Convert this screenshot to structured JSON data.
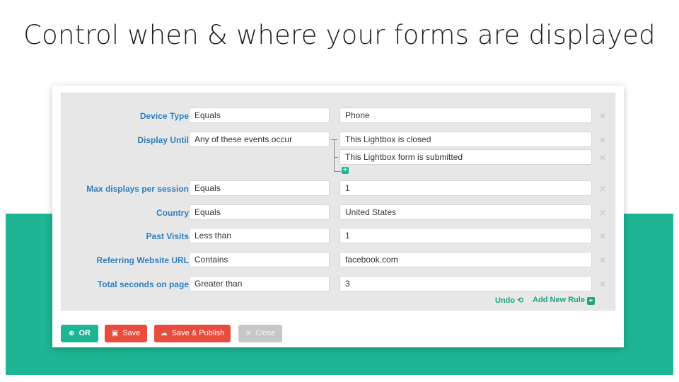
{
  "headline": "Control when & where your forms are displayed",
  "rules": [
    {
      "label": "Device Type",
      "operator": "Equals",
      "values": [
        "Phone"
      ]
    },
    {
      "label": "Display Until",
      "operator": "Any of these events occur",
      "values": [
        "This Lightbox is closed",
        "This Lightbox form is submitted"
      ]
    },
    {
      "label": "Max displays per session",
      "operator": "Equals",
      "values": [
        "1"
      ]
    },
    {
      "label": "Country",
      "operator": "Equals",
      "values": [
        "United States"
      ]
    },
    {
      "label": "Past Visits",
      "operator": "Less than",
      "values": [
        "1"
      ]
    },
    {
      "label": "Referring Website URL",
      "operator": "Contains",
      "values": [
        "facebook.com"
      ]
    },
    {
      "label": "Total seconds on page",
      "operator": "Greater than",
      "values": [
        "3"
      ]
    }
  ],
  "panel_actions": {
    "undo": "Undo",
    "add_rule": "Add New Rule"
  },
  "buttons": {
    "or": "OR",
    "save": "Save",
    "save_publish": "Save & Publish",
    "close": "Close"
  },
  "icons": {
    "remove": "close-x-icon",
    "undo": "undo-icon",
    "add": "plus-square-icon",
    "or": "plus-circle-icon",
    "save": "floppy-disk-icon",
    "publish": "cloud-upload-icon",
    "close": "x-icon"
  },
  "colors": {
    "teal": "#1db593",
    "link_blue": "#2f7fc1",
    "red": "#e74c3c",
    "gray_button": "#c7c7c7"
  }
}
